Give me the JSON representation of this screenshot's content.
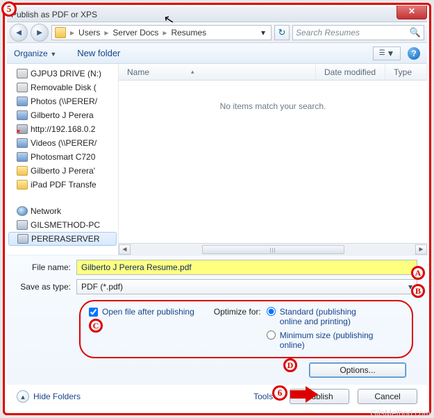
{
  "titlebar": {
    "title": "Publish as PDF or XPS",
    "faded": ""
  },
  "breadcrumb": {
    "segments": [
      "Users",
      "Server Docs",
      "Resumes"
    ]
  },
  "search": {
    "placeholder": "Search Resumes"
  },
  "toolbar": {
    "organize": "Organize",
    "newfolder": "New folder"
  },
  "sidebar": {
    "items": [
      {
        "label": "GJPU3 DRIVE (N:)",
        "icon": "drive"
      },
      {
        "label": "Removable Disk (",
        "icon": "drive"
      },
      {
        "label": "Photos (\\\\PERER/",
        "icon": "net"
      },
      {
        "label": "Gilberto J Perera",
        "icon": "net"
      },
      {
        "label": "http://192.168.0.2",
        "icon": "broken"
      },
      {
        "label": "Videos (\\\\PERER/",
        "icon": "net"
      },
      {
        "label": "Photosmart C720",
        "icon": "net"
      },
      {
        "label": "Gilberto J Perera'",
        "icon": "folder"
      },
      {
        "label": "iPad PDF Transfe",
        "icon": "folder"
      }
    ],
    "network": {
      "label": "Network",
      "items": [
        "GILSMETHOD-PC",
        "PERERASERVER"
      ]
    }
  },
  "columns": {
    "name": "Name",
    "date": "Date modified",
    "type": "Type"
  },
  "filelist": {
    "empty": "No items match your search."
  },
  "form": {
    "filename_label": "File name:",
    "filename_value": "Gilberto J Perera Resume.pdf",
    "saveas_label": "Save as type:",
    "saveas_value": "PDF (*.pdf)"
  },
  "options": {
    "open_after": "Open file after publishing",
    "optimize_label": "Optimize for:",
    "standard": "Standard (publishing online and printing)",
    "minimum": "Minimum size (publishing online)",
    "options_btn": "Options...",
    "selected": "standard"
  },
  "footer": {
    "hide": "Hide Folders",
    "tools": "Tools",
    "publish": "Publish",
    "cancel": "Cancel"
  },
  "markers": {
    "m5": "5",
    "mA": "A",
    "mB": "B",
    "mC": "C",
    "mD": "D",
    "m6": "6"
  },
  "watermark": "GilsMethod.com"
}
